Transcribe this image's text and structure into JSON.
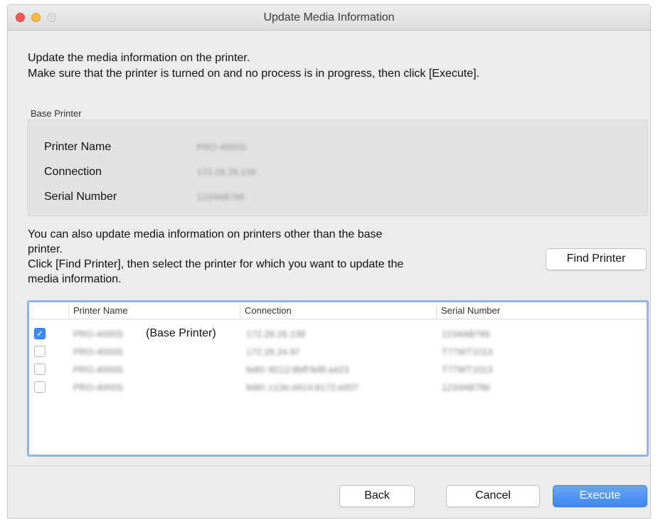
{
  "window": {
    "title": "Update Media Information"
  },
  "intro": {
    "line1": "Update the media information on the printer.",
    "line2": "Make sure that the printer is turned on and no process is in progress, then click [Execute]."
  },
  "base_printer": {
    "group_label": "Base Printer",
    "fields": [
      {
        "label": "Printer Name",
        "value": "PRO-4000S"
      },
      {
        "label": "Connection",
        "value": "172.28.26.138"
      },
      {
        "label": "Serial Number",
        "value": "1234AB786"
      }
    ]
  },
  "other_printers": {
    "line1": "You can also update media information on printers other than the base",
    "line2": "printer.",
    "line3": "Click [Find Printer], then select the printer for which you want to update the",
    "line4": "media information.",
    "find_button": "Find Printer"
  },
  "printer_list": {
    "columns": [
      "Printer Name",
      "Connection",
      "Serial Number"
    ],
    "base_suffix": "(Base Printer)",
    "rows": [
      {
        "checked": true,
        "name": "PRO-4000S",
        "connection": "172.28.26.138",
        "serial": "1234AB786"
      },
      {
        "checked": false,
        "name": "PRO-4000S",
        "connection": "172.28.24.97",
        "serial": "T77WT1013"
      },
      {
        "checked": false,
        "name": "PRO-4000S",
        "connection": "fe80::8212:8bff:fef8:a423",
        "serial": "T77WT1013"
      },
      {
        "checked": false,
        "name": "PRO-4000S",
        "connection": "fe80::c13e:d414:8172:e007",
        "serial": "1234AB786"
      }
    ]
  },
  "buttons": {
    "back": "Back",
    "cancel": "Cancel",
    "execute": "Execute"
  },
  "colors": {
    "accent": "#3d87f0",
    "list_focus": "#8fb3ec"
  }
}
